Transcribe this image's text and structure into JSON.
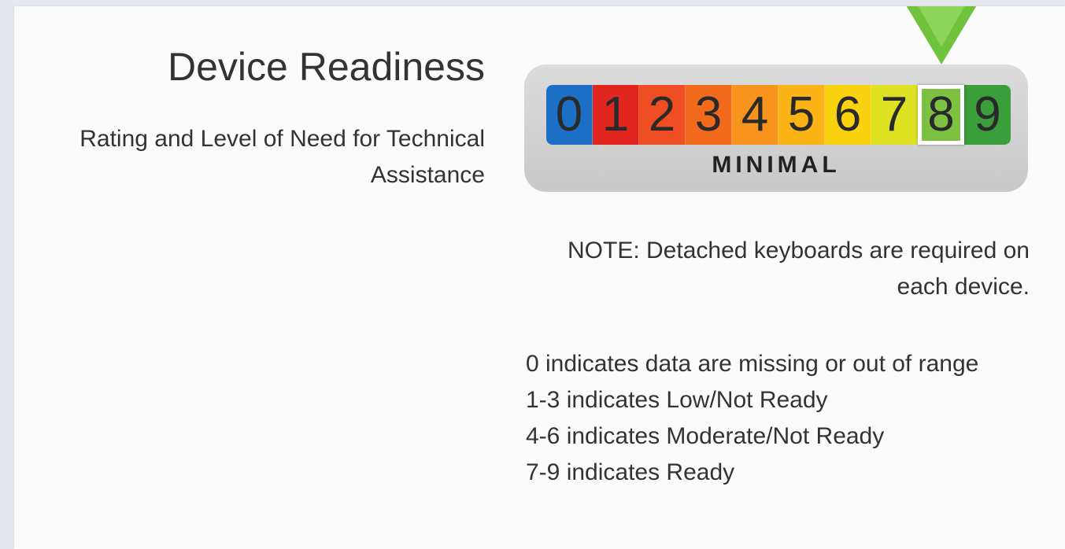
{
  "header": {
    "title": "Device Readiness",
    "subtitle": "Rating and Level of Need for Technical Assistance"
  },
  "meter": {
    "selected_value": 8,
    "level_label": "MINIMAL",
    "digits": [
      {
        "label": "0",
        "color": "#1b6fc4"
      },
      {
        "label": "1",
        "color": "#e0261f"
      },
      {
        "label": "2",
        "color": "#ee4e22"
      },
      {
        "label": "3",
        "color": "#f26b1d"
      },
      {
        "label": "4",
        "color": "#f7941d"
      },
      {
        "label": "5",
        "color": "#fbb315"
      },
      {
        "label": "6",
        "color": "#fbd20f"
      },
      {
        "label": "7",
        "color": "#dfe223"
      },
      {
        "label": "8",
        "color": "#7dc142"
      },
      {
        "label": "9",
        "color": "#3a9e3a"
      }
    ]
  },
  "note": {
    "text": "NOTE: Detached keyboards are required on each device."
  },
  "legend": {
    "line_0": "0 indicates data are missing or out of range",
    "line_1": "1-3 indicates Low/Not Ready",
    "line_2": "4-6 indicates Moderate/Not Ready",
    "line_3": "7-9 indicates Ready"
  }
}
